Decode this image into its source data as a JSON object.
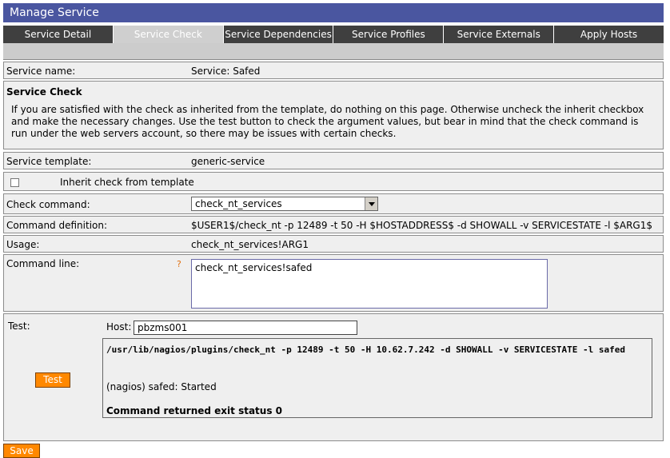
{
  "window": {
    "title": "Manage Service"
  },
  "tabs": [
    {
      "label": "Service Detail",
      "active": false
    },
    {
      "label": "Service Check",
      "active": true
    },
    {
      "label": "Service Dependencies",
      "active": false
    },
    {
      "label": "Service Profiles",
      "active": false
    },
    {
      "label": "Service Externals",
      "active": false
    },
    {
      "label": "Apply Hosts",
      "active": false
    }
  ],
  "service_name": {
    "label": "Service name:",
    "value": "Service: Safed"
  },
  "service_check": {
    "title": "Service Check",
    "description": "If you are satisfied with the check as inherited from the template, do nothing on this page. Otherwise uncheck the inherit checkbox and make the necessary changes. Use the test button to check the argument values, but bear in mind that the check command is run under the web servers account, so there may be issues with certain checks."
  },
  "service_template": {
    "label": "Service template:",
    "value": "generic-service"
  },
  "inherit": {
    "label": "Inherit check from template",
    "checked": false
  },
  "check_command": {
    "label": "Check command:",
    "selected": "check_nt_services"
  },
  "command_definition": {
    "label": "Command definition:",
    "value": "$USER1$/check_nt -p 12489 -t 50 -H $HOSTADDRESS$ -d SHOWALL -v SERVICESTATE -l $ARG1$"
  },
  "usage": {
    "label": "Usage:",
    "value": "check_nt_services!ARG1"
  },
  "command_line": {
    "label": "Command line:",
    "help": "?",
    "value": "check_nt_services!safed"
  },
  "test": {
    "label": "Test:",
    "host_label": "Host:",
    "host_value": "pbzms001",
    "button": "Test",
    "output_command": "/usr/lib/nagios/plugins/check_nt -p 12489 -t 50 -H 10.62.7.242 -d SHOWALL -v SERVICESTATE -l safed",
    "output_result": "(nagios) safed: Started",
    "output_status": "Command returned exit status 0"
  },
  "save_button": "Save",
  "colors": {
    "title_bar": "#4a56a0",
    "tab": "#3f3f3f",
    "tab_active": "#cfcfcf",
    "button": "#ff8800",
    "panel": "#efefef"
  }
}
